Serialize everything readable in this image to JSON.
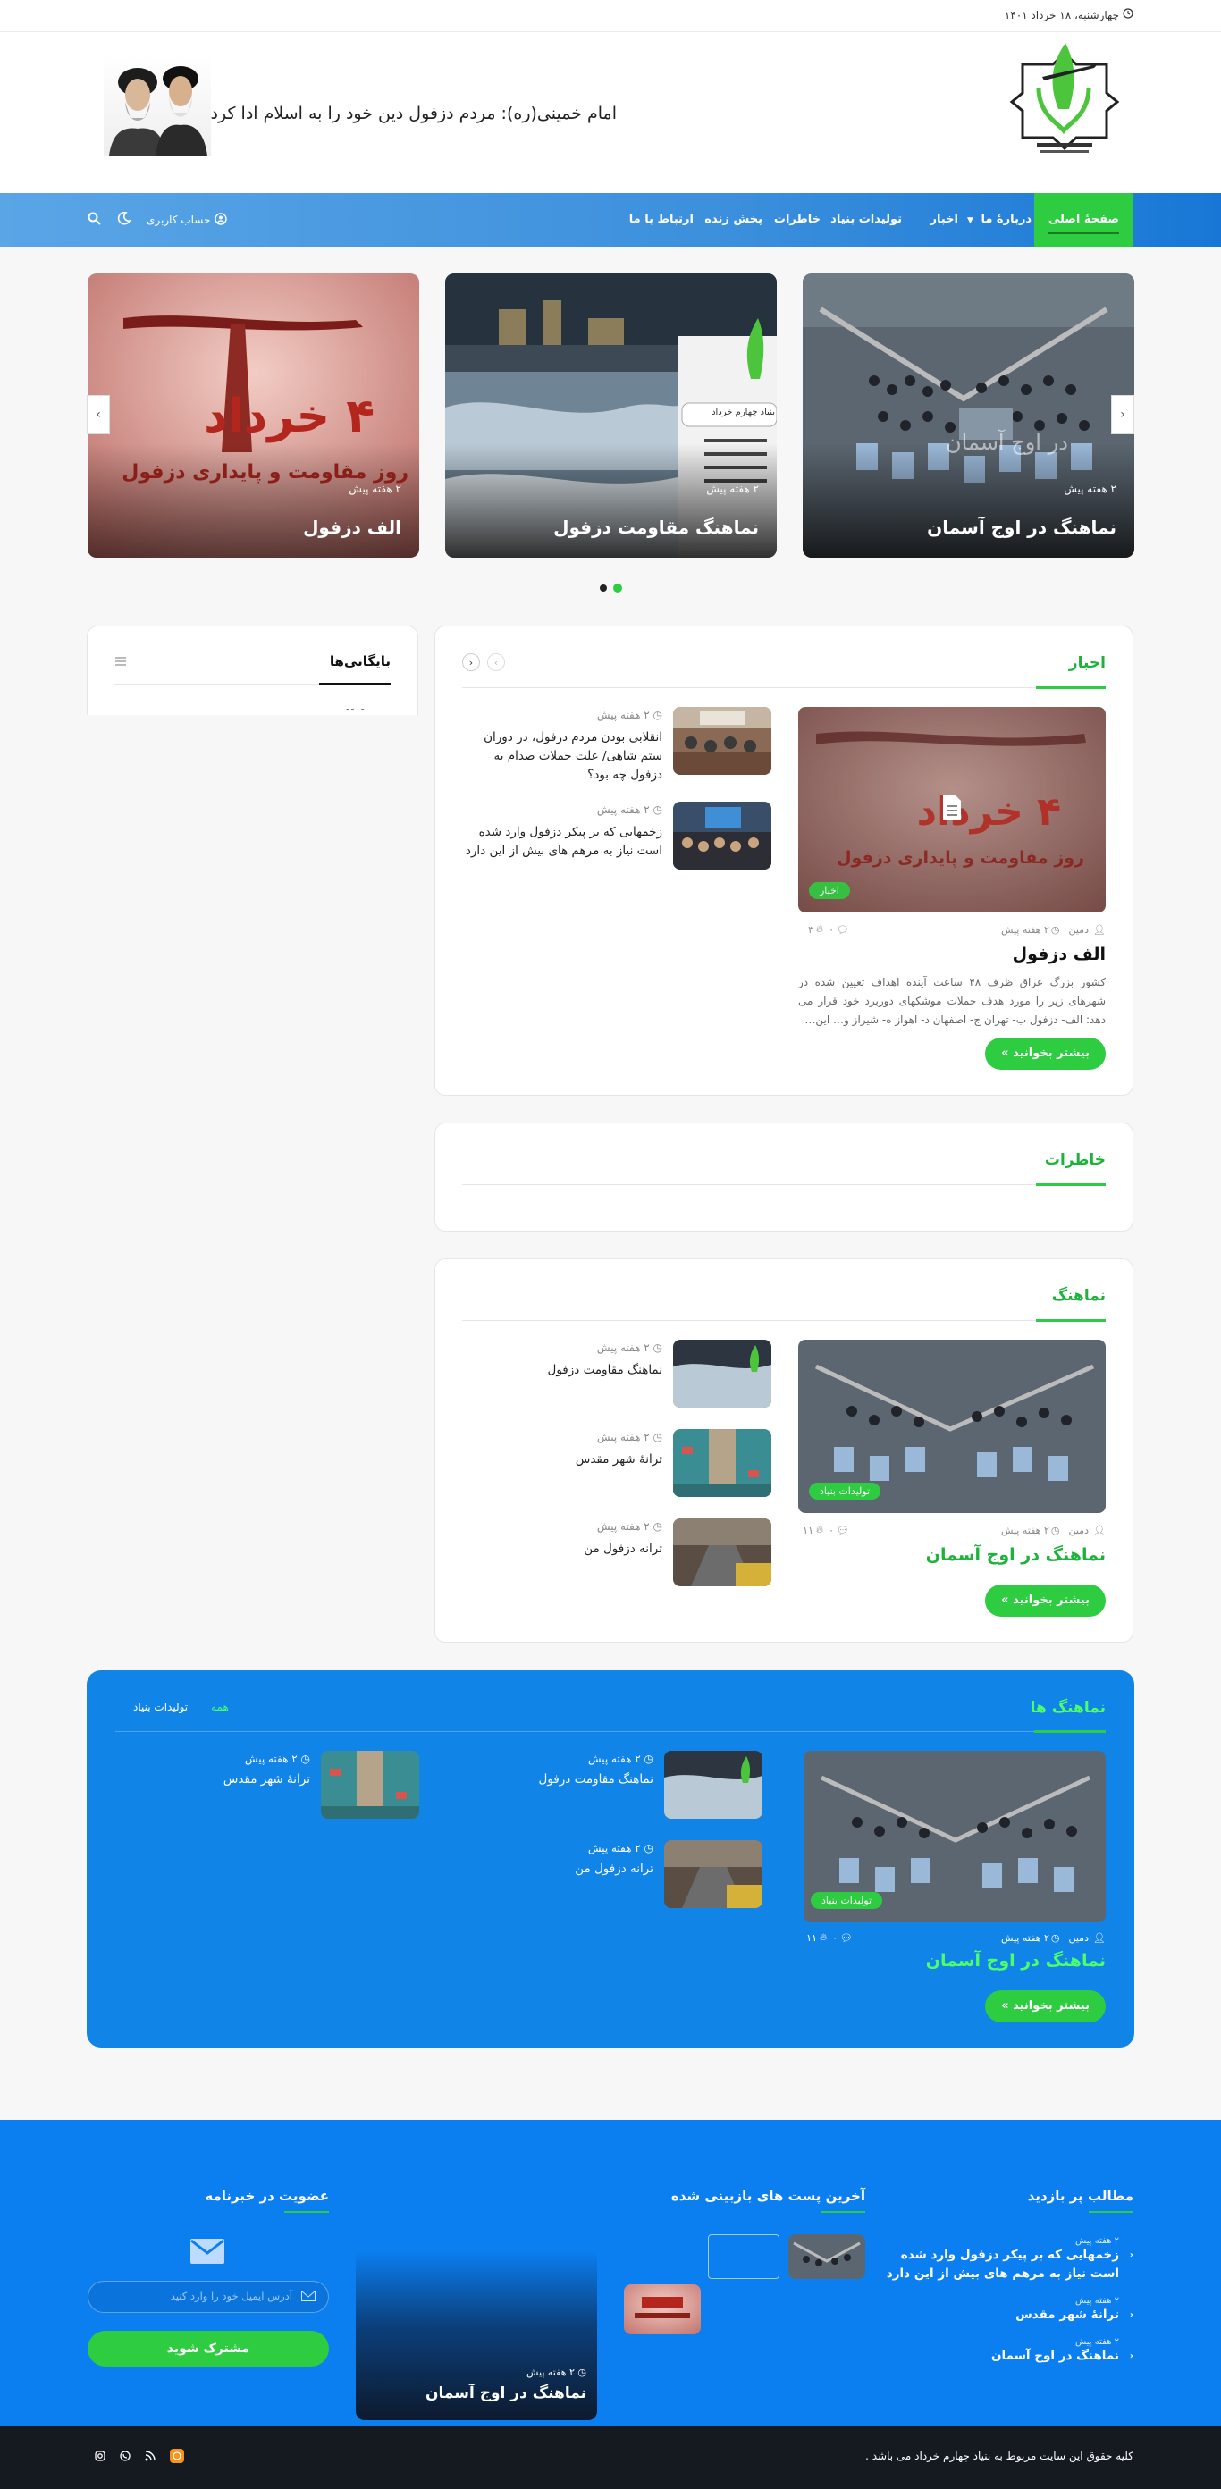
{
  "topbar": {
    "date": "چهارشنبه، ۱۸ خرداد ۱۴۰۱"
  },
  "header": {
    "quote": "امام خمینی(ره): مردم دزفول دین خود را به اسلام ادا کردند"
  },
  "nav": {
    "items": [
      "صفحهٔ اصلی",
      "دربارهٔ ما",
      "اخبار",
      "تولیدات بنیاد",
      "خاطرات",
      "پخش زنده",
      "ارتباط با ما"
    ],
    "account": "حساب کاربری"
  },
  "slider": {
    "slides": [
      {
        "title": "نماهنگ در اوج آسمان",
        "time": "۲ هفته پیش",
        "overlay_text": "در اوج آسمان"
      },
      {
        "title": "نماهنگ مقاومت دزفول",
        "time": "۲ هفته پیش",
        "overlay_text": "بنیاد چهارم خرداد"
      },
      {
        "title": "الف دزفول",
        "time": "۲ هفته پیش",
        "overlay_text_1": "۴ خرداد",
        "overlay_text_2": "روز مقاومت و پایداری دزفول"
      }
    ]
  },
  "news": {
    "title": "اخبار",
    "main": {
      "author": "ادمین",
      "time": "۲ هفته پیش",
      "likes": "۳",
      "comments": "۰",
      "title": "الف دزفول",
      "excerpt": "کشور بزرگ عراق ظرف ۴۸ ساعت آینده اهداف تعیین شده در شهرهای زیر را مورد هدف حملات موشکهای دوربرد خود قرار می دهد: الف- دزفول ب- تهران ج- اصفهان د- اهواز ه- شیراز و… این…",
      "badge": "اخبار",
      "more": "بیشتر بخوانید »",
      "image_text_1": "۴ خرداد",
      "image_text_2": "روز مقاومت و پایداری دزفول"
    },
    "list": [
      {
        "time": "۲ هفته پیش",
        "title": "انقلابی بودن مردم دزفول، در دوران ستم شاهی/ علت حملات صدام به دزفول چه بود؟"
      },
      {
        "time": "۲ هفته پیش",
        "title": "زخمهایی که بر پیکر دزفول وارد شده است نیاز به مرهم های بیش از این دارد"
      }
    ]
  },
  "archive": {
    "title": "بایگانی‌ها",
    "fragment": "ـ ‌ ‌ ـ ـ"
  },
  "memories": {
    "title": "خاطرات"
  },
  "clip": {
    "title": "نماهنگ",
    "main": {
      "author": "ادمین",
      "time": "۲ هفته پیش",
      "likes": "۱۱",
      "comments": "۰",
      "title": "نماهنگ در اوج آسمان",
      "badge": "تولیدات بنیاد",
      "more": "بیشتر بخوانید »"
    },
    "list": [
      {
        "time": "۲ هفته پیش",
        "title": "نماهنگ مقاومت دزفول"
      },
      {
        "time": "۲ هفته پیش",
        "title": "ترانهٔ شهر مقدس"
      },
      {
        "time": "۲ هفته پیش",
        "title": "ترانه دزفول من"
      }
    ]
  },
  "clips_block": {
    "title": "نماهنگ ها",
    "tabs": [
      "همه",
      "تولیدات بنیاد"
    ],
    "main": {
      "author": "ادمین",
      "time": "۲ هفته پیش",
      "likes": "۱۱",
      "comments": "۰",
      "title": "نماهنگ در اوج آسمان",
      "badge": "تولیدات بنیاد",
      "more": "بیشتر بخوانید »"
    },
    "list": [
      {
        "time": "۲ هفته پیش",
        "title": "نماهنگ مقاومت دزفول"
      },
      {
        "time": "۲ هفته پیش",
        "title": "ترانه دزفول من"
      },
      {
        "time": "۲ هفته پیش",
        "title": "ترانهٔ شهر مقدس"
      }
    ]
  },
  "footer": {
    "popular": {
      "title": "مطالب پر بازدید",
      "items": [
        {
          "time": "۲ هفته پیش",
          "title": "زخمهایی که بر پیکر دزفول وارد شده است نیاز به مرهم های بیش از این دارد"
        },
        {
          "time": "۲ هفته پیش",
          "title": "ترانهٔ شهر مقدس"
        },
        {
          "time": "۲ هفته پیش",
          "title": "نماهنگ در اوج آسمان"
        }
      ]
    },
    "recent": {
      "title": "آخرین پست های بازبینی شده"
    },
    "featured": {
      "time": "۲ هفته پیش",
      "title": "نماهنگ در اوج آسمان"
    },
    "newsletter": {
      "title": "عضویت در خبرنامه",
      "placeholder": "آدرس ایمیل خود را وارد کنید",
      "button": "مشترک شوید"
    }
  },
  "copyright": {
    "text": "کلیه حقوق این سایت مربوط به بنیاد چهارم خرداد می باشد ."
  },
  "colors": {
    "accent": "#2ecc40",
    "nav": "#3b8fdc",
    "footer": "#0b7ff0",
    "footer_bottom": "#151a21"
  }
}
